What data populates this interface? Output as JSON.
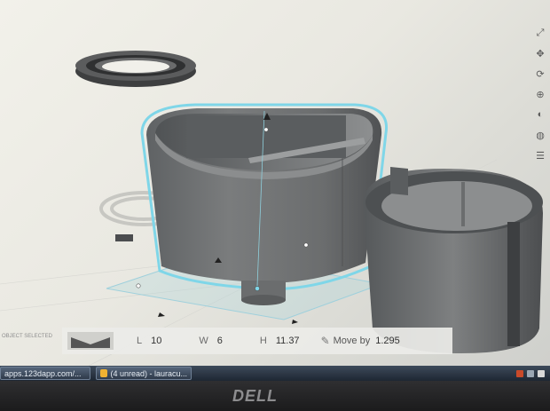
{
  "toolbar_icons": [
    "expand-icon",
    "pan-icon",
    "rotate-icon",
    "zoom-icon",
    "view-icon",
    "fit-icon",
    "grid-icon"
  ],
  "selection": {
    "label": "OBJECT SELECTED",
    "length_label": "L",
    "length_value": "10",
    "width_label": "W",
    "width_value": "6",
    "height_label": "H",
    "height_value": "11.37",
    "move_label": "Move by",
    "move_value": "1.295"
  },
  "taskbar": {
    "items": [
      {
        "label": "apps.123dapp.com/...",
        "icon_color": "#3a6fb0"
      },
      {
        "label": "(4 unread) - lauracu...",
        "icon_color": "#f0b232"
      }
    ]
  },
  "monitor": {
    "brand": "DELL"
  },
  "colors": {
    "selection_outline": "#7fd6e8",
    "object_fill": "#6d6f70",
    "screen_bg": "#eceae3"
  }
}
